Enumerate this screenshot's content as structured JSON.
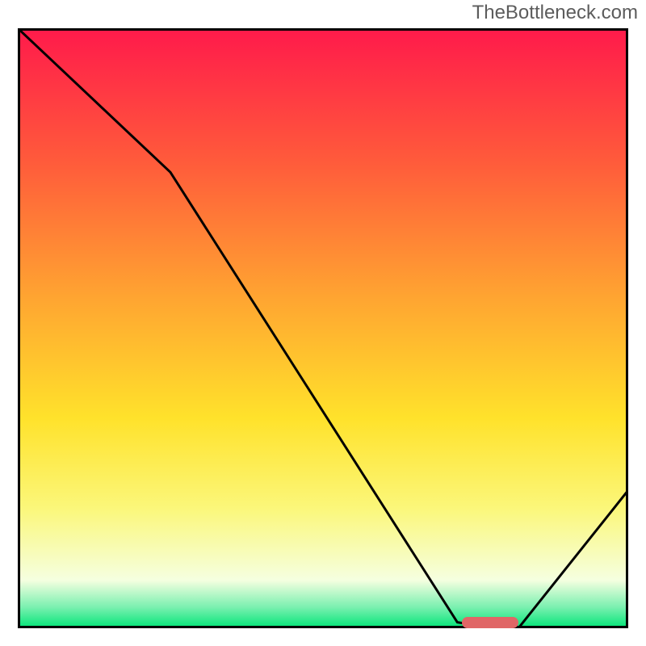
{
  "watermark": "TheBottleneck.com",
  "chart_data": {
    "type": "line",
    "title": "",
    "xlabel": "",
    "ylabel": "",
    "xlim": [
      0,
      100
    ],
    "ylim": [
      0,
      100
    ],
    "grid": false,
    "legend": false,
    "background_gradient": {
      "stops": [
        {
          "pos": 0.0,
          "color": "#ff1a4b"
        },
        {
          "pos": 0.22,
          "color": "#ff5a3b"
        },
        {
          "pos": 0.45,
          "color": "#ffa531"
        },
        {
          "pos": 0.65,
          "color": "#ffe22b"
        },
        {
          "pos": 0.8,
          "color": "#fbf77a"
        },
        {
          "pos": 0.92,
          "color": "#f5ffe0"
        },
        {
          "pos": 0.965,
          "color": "#7af0b0"
        },
        {
          "pos": 1.0,
          "color": "#00e576"
        }
      ]
    },
    "series": [
      {
        "name": "curve",
        "x": [
          0,
          25,
          72,
          78,
          82,
          100
        ],
        "y": [
          100,
          76,
          1,
          0,
          0,
          23
        ],
        "color": "#000000"
      }
    ],
    "flat_segment": {
      "x_start": 73,
      "x_end": 82,
      "y": 0.9,
      "color": "#e06666"
    },
    "border": {
      "color": "#000000",
      "width": 6
    }
  }
}
